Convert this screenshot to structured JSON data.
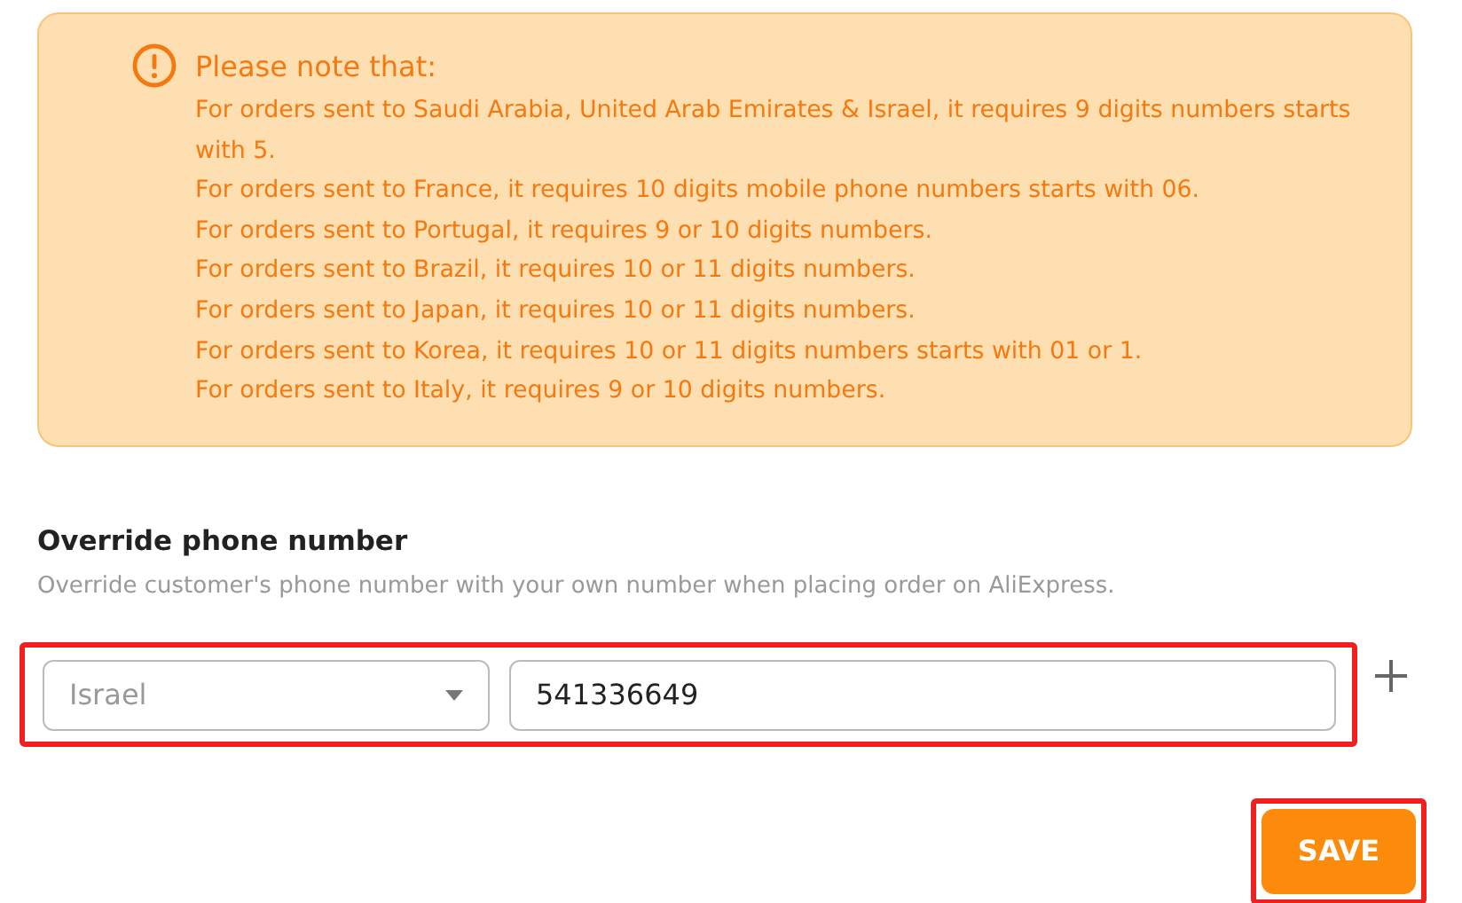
{
  "notice": {
    "title": "Please note that:",
    "lines": [
      "For orders sent to Saudi Arabia, United Arab Emirates & Israel, it requires 9 digits numbers starts with 5.",
      "For orders sent to France, it requires 10 digits mobile phone numbers starts with 06.",
      "For orders sent to Portugal, it requires 9 or 10 digits numbers.",
      "For orders sent to Brazil, it requires 10 or 11 digits numbers.",
      "For orders sent to Japan, it requires 10 or 11 digits numbers.",
      "For orders sent to Korea, it requires 10 or 11 digits numbers starts with 01 or 1.",
      "For orders sent to Italy, it requires 9 or 10 digits numbers."
    ]
  },
  "override": {
    "title": "Override phone number",
    "description": "Override customer's phone number with your own number when placing order on AliExpress.",
    "country": "Israel",
    "phone": "541336649",
    "highlighted": true
  },
  "save": {
    "label": "SAVE",
    "highlighted": true
  }
}
